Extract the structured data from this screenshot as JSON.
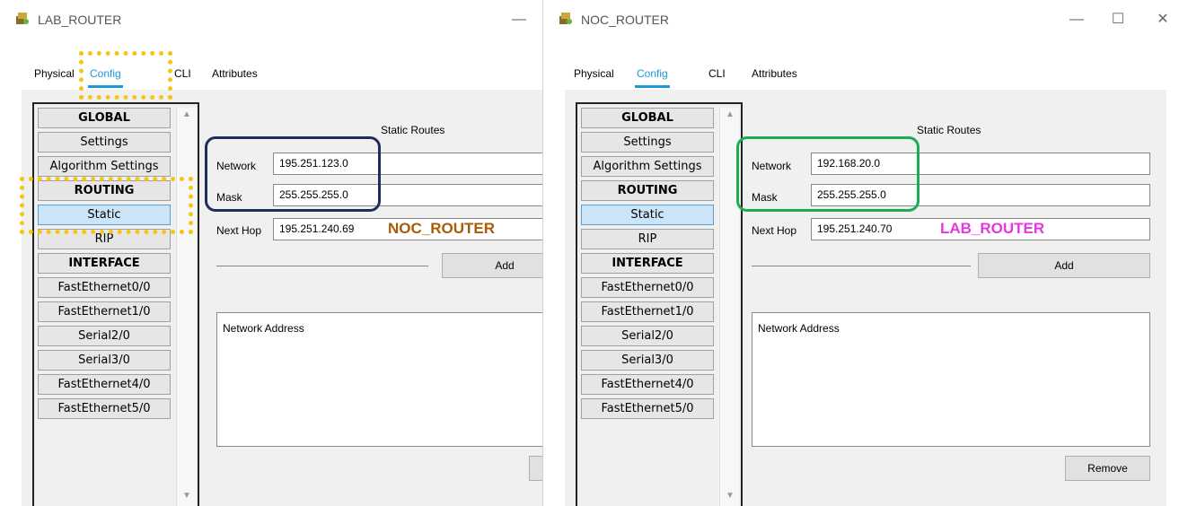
{
  "colors": {
    "accent": "#1a9ad6",
    "selected_bg": "#cce4f7",
    "highlight_config": "#f5c518",
    "outline_left": "#1f2d5a",
    "outline_right": "#1aad52",
    "tag_left": "#a85b08",
    "tag_right": "#e836e0"
  },
  "left": {
    "title": "LAB_ROUTER",
    "icon": "router-icon",
    "controls": {
      "minimize": "—"
    },
    "tabs": [
      "Physical",
      "Config",
      "CLI",
      "Attributes"
    ],
    "sidebar": [
      {
        "label": "GLOBAL",
        "type": "header"
      },
      {
        "label": "Settings",
        "type": "item"
      },
      {
        "label": "Algorithm Settings",
        "type": "item"
      },
      {
        "label": "ROUTING",
        "type": "header"
      },
      {
        "label": "Static",
        "type": "selected"
      },
      {
        "label": "RIP",
        "type": "item"
      },
      {
        "label": "INTERFACE",
        "type": "header"
      },
      {
        "label": "FastEthernet0/0",
        "type": "item"
      },
      {
        "label": "FastEthernet1/0",
        "type": "item"
      },
      {
        "label": "Serial2/0",
        "type": "item"
      },
      {
        "label": "Serial3/0",
        "type": "item"
      },
      {
        "label": "FastEthernet4/0",
        "type": "item"
      },
      {
        "label": "FastEthernet5/0",
        "type": "item"
      }
    ],
    "section_title": "Static Routes",
    "network_label": "Network",
    "network_value": "195.251.123.0",
    "mask_label": "Mask",
    "mask_value": "255.255.255.0",
    "nexthop_label": "Next Hop",
    "nexthop_value": "195.251.240.69",
    "nexthop_tag": "NOC_ROUTER",
    "add_label": "Add",
    "list_header": "Network Address"
  },
  "right": {
    "title": "NOC_ROUTER",
    "icon": "router-icon",
    "controls": {
      "minimize": "—",
      "maximize": "☐",
      "close": "✕"
    },
    "tabs": [
      "Physical",
      "Config",
      "CLI",
      "Attributes"
    ],
    "sidebar": [
      {
        "label": "GLOBAL",
        "type": "header"
      },
      {
        "label": "Settings",
        "type": "item"
      },
      {
        "label": "Algorithm Settings",
        "type": "item"
      },
      {
        "label": "ROUTING",
        "type": "header"
      },
      {
        "label": "Static",
        "type": "selected"
      },
      {
        "label": "RIP",
        "type": "item"
      },
      {
        "label": "INTERFACE",
        "type": "header"
      },
      {
        "label": "FastEthernet0/0",
        "type": "item"
      },
      {
        "label": "FastEthernet1/0",
        "type": "item"
      },
      {
        "label": "Serial2/0",
        "type": "item"
      },
      {
        "label": "Serial3/0",
        "type": "item"
      },
      {
        "label": "FastEthernet4/0",
        "type": "item"
      },
      {
        "label": "FastEthernet5/0",
        "type": "item"
      }
    ],
    "section_title": "Static Routes",
    "network_label": "Network",
    "network_value": "192.168.20.0",
    "mask_label": "Mask",
    "mask_value": "255.255.255.0",
    "nexthop_label": "Next Hop",
    "nexthop_value": "195.251.240.70",
    "nexthop_tag": "LAB_ROUTER",
    "add_label": "Add",
    "list_header": "Network Address",
    "remove_label": "Remove"
  }
}
